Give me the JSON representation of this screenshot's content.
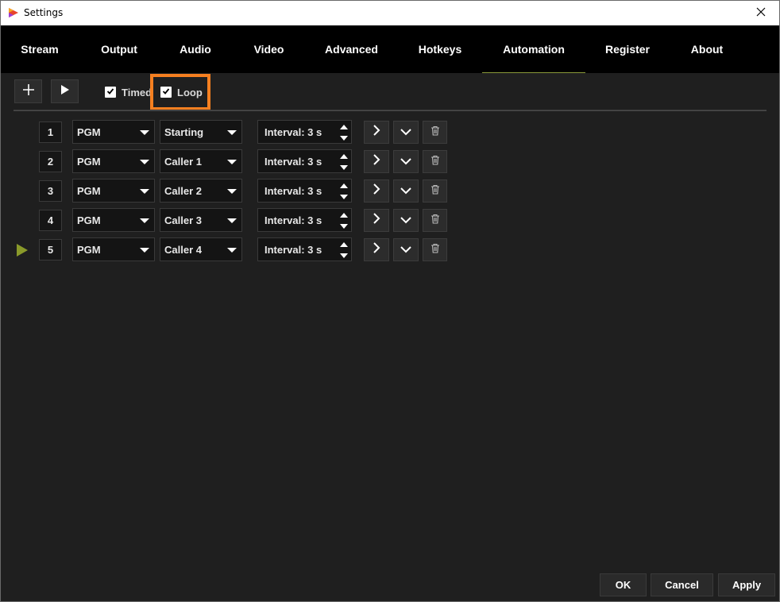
{
  "window": {
    "title": "Settings"
  },
  "tabs": [
    {
      "label": "Stream"
    },
    {
      "label": "Output"
    },
    {
      "label": "Audio"
    },
    {
      "label": "Video"
    },
    {
      "label": "Advanced"
    },
    {
      "label": "Hotkeys"
    },
    {
      "label": "Automation",
      "active": true
    },
    {
      "label": "Register"
    },
    {
      "label": "About"
    }
  ],
  "toolbar": {
    "add_icon": "plus-icon",
    "play_icon": "play-icon",
    "timed": {
      "label": "Timed",
      "checked": true
    },
    "loop": {
      "label": "Loop",
      "checked": true
    }
  },
  "rows": [
    {
      "index": "1",
      "source": "PGM",
      "scene": "Starting",
      "interval": "Interval: 3 s",
      "current": false
    },
    {
      "index": "2",
      "source": "PGM",
      "scene": "Caller 1",
      "interval": "Interval: 3 s",
      "current": false
    },
    {
      "index": "3",
      "source": "PGM",
      "scene": "Caller 2",
      "interval": "Interval: 3 s",
      "current": false
    },
    {
      "index": "4",
      "source": "PGM",
      "scene": "Caller 3",
      "interval": "Interval: 3 s",
      "current": false
    },
    {
      "index": "5",
      "source": "PGM",
      "scene": "Caller 4",
      "interval": "Interval: 3 s",
      "current": true
    }
  ],
  "footer": {
    "ok": "OK",
    "cancel": "Cancel",
    "apply": "Apply"
  },
  "colors": {
    "highlight": "#f57f20",
    "accent": "#8a9a2a",
    "background": "#1f1f1f"
  }
}
